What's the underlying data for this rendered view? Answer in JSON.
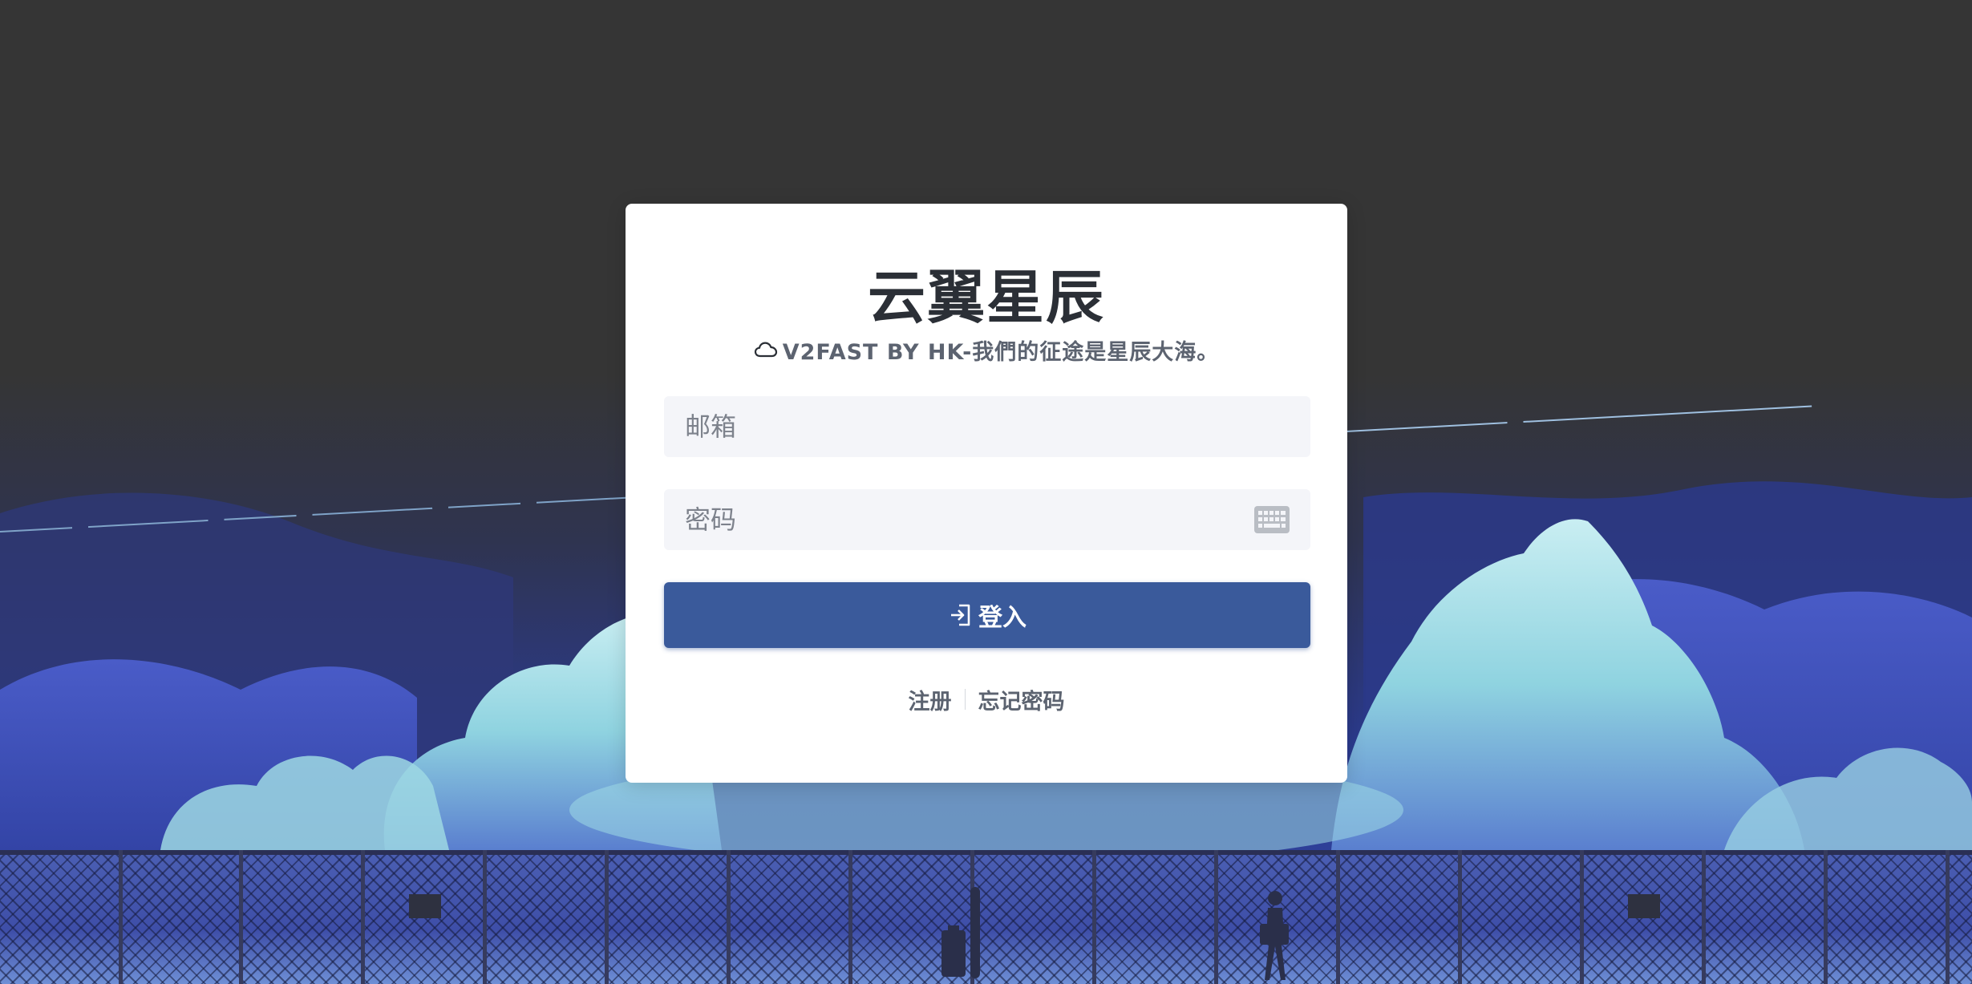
{
  "brand": {
    "title": "云翼星辰",
    "subtitle": "V2FAST BY HK-我們的征途是星辰大海。",
    "subtitle_icon": "cloud-icon"
  },
  "form": {
    "email_placeholder": "邮箱",
    "password_placeholder": "密码",
    "password_icon": "keyboard-icon",
    "login_label": "登入",
    "login_icon": "sign-in-icon"
  },
  "links": {
    "register": "注册",
    "forgot_password": "忘记密码"
  },
  "colors": {
    "primary": "#3a5a9b",
    "card": "#ffffff",
    "input_bg": "#f4f5f9",
    "title": "#2b2f36",
    "muted": "#5c6370"
  }
}
